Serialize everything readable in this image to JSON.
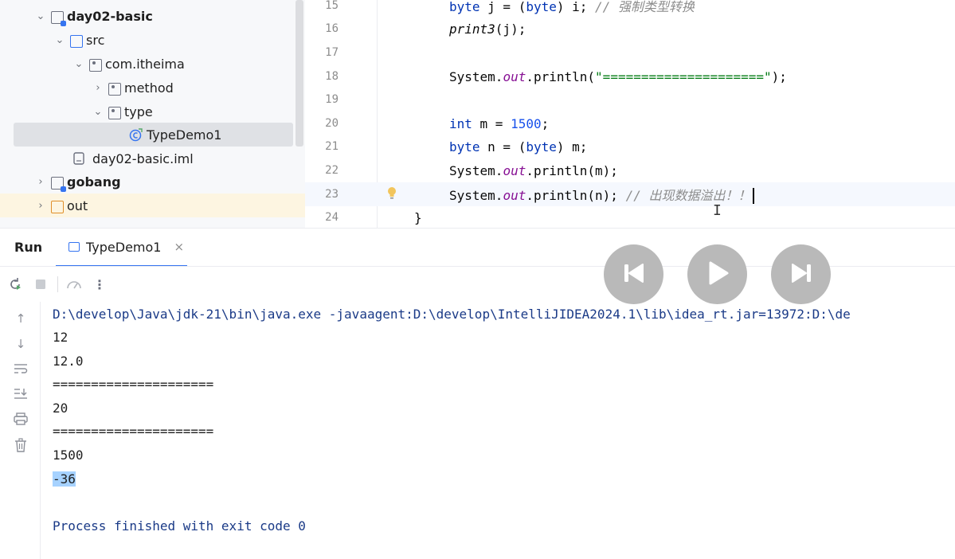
{
  "tree": {
    "items": [
      {
        "label": "day02-basic",
        "bold": true,
        "chevron": "⌄",
        "icon": "module-folder"
      },
      {
        "label": "src",
        "bold": false,
        "chevron": "⌄",
        "icon": "source-folder"
      },
      {
        "label": "com.itheima",
        "bold": false,
        "chevron": "⌄",
        "icon": "package"
      },
      {
        "label": "method",
        "bold": false,
        "chevron": "›",
        "icon": "package"
      },
      {
        "label": "type",
        "bold": false,
        "chevron": "⌄",
        "icon": "package"
      },
      {
        "label": "TypeDemo1",
        "bold": false,
        "chevron": "",
        "icon": "java-class"
      },
      {
        "label": "day02-basic.iml",
        "bold": false,
        "chevron": "",
        "icon": "iml-file"
      },
      {
        "label": "gobang",
        "bold": true,
        "chevron": "›",
        "icon": "module-folder"
      },
      {
        "label": "out",
        "bold": false,
        "chevron": "›",
        "icon": "excluded-folder"
      }
    ]
  },
  "editor": {
    "line_numbers": [
      "15",
      "16",
      "17",
      "18",
      "19",
      "20",
      "21",
      "22",
      "23",
      "24"
    ],
    "current_line": "23"
  },
  "run": {
    "title": "Run",
    "tab_label": "TypeDemo1",
    "tab_close": "×",
    "toolbar_icons": [
      "rerun-icon",
      "stop-icon",
      "coverage-icon",
      "more-icon"
    ]
  },
  "console": {
    "lines": [
      "D:\\develop\\Java\\jdk-21\\bin\\java.exe -javaagent:D:\\develop\\IntelliJIDEA2024.1\\lib\\idea_rt.jar=13972:D:\\de",
      "12",
      "12.0",
      "=====================",
      "20",
      "=====================",
      "1500",
      "-36",
      "",
      "Process finished with exit code 0"
    ]
  },
  "media_controls": [
    "previous-icon",
    "play-icon",
    "next-icon"
  ],
  "colors": {
    "keyword": "#0033b3",
    "number": "#1750eb",
    "string": "#067d17",
    "static_field": "#871094",
    "comment": "#8c8c8c",
    "selection": "#a6d2ff",
    "accent": "#3574f0"
  }
}
